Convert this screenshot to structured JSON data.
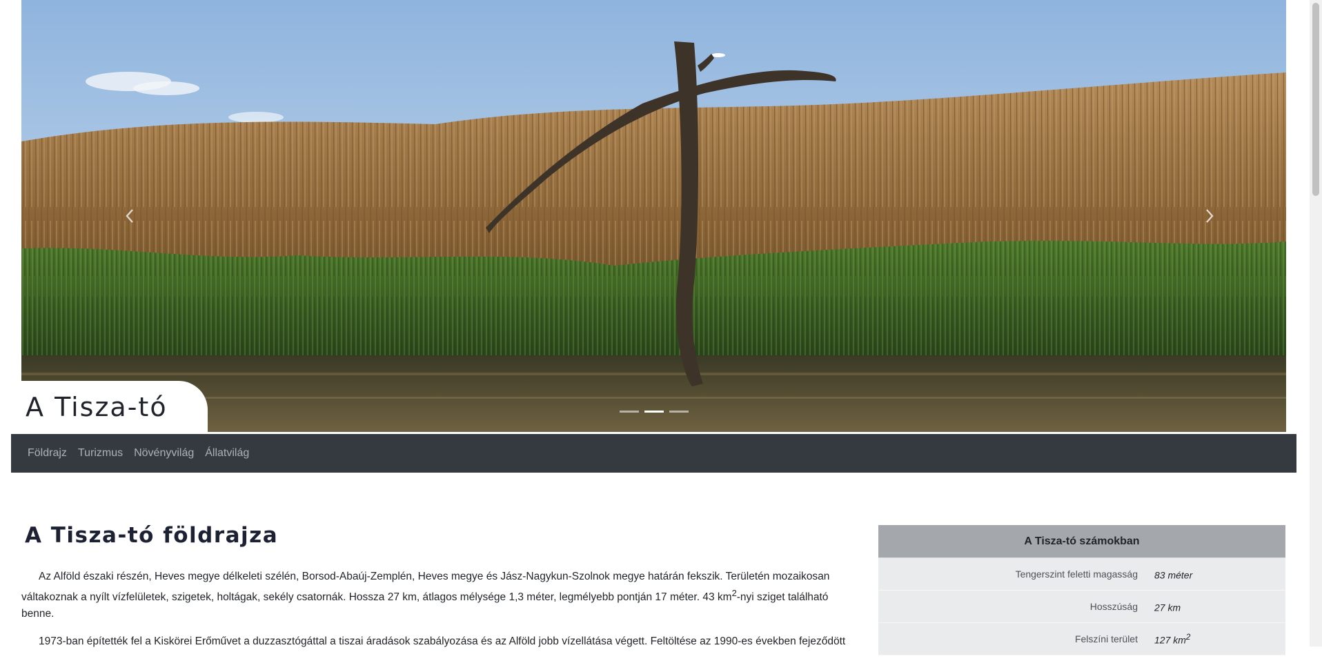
{
  "carousel": {
    "site_title": "A Tisza-tó",
    "prev_icon": "chevron-left-icon",
    "next_icon": "chevron-right-icon",
    "slide_count": 3,
    "active_slide": 2
  },
  "nav": {
    "items": [
      {
        "label": "Földrajz"
      },
      {
        "label": "Turizmus"
      },
      {
        "label": "Növényvilág"
      },
      {
        "label": "Állatvilág"
      }
    ]
  },
  "main": {
    "heading": "A Tisza-tó földrajza",
    "p1_before_sup": "Az Alföld északi részén, Heves megye délkeleti szélén, Borsod-Abaúj-Zemplén, Heves megye és Jász-Nagykun-Szolnok megye határán fekszik. Területén mozaikosan váltakoznak a nyílt vízfelületek, szigetek, holtágak, sekély csatornák. Hossza 27 km, átlagos mélysége 1,3 méter, legmélyebb pontján 17 méter. 43 km",
    "p1_sup": "2",
    "p1_after_sup": "-nyi sziget található benne.",
    "p2": "1973-ban építették fel a Kiskörei Erőművet a duzzasztógáttal a tiszai áradások szabályozása és az Alföld jobb vízellátása végett. Feltöltése az 1990-es években fejeződött"
  },
  "info": {
    "title": "A Tisza-tó számokban",
    "rows": [
      {
        "label": "Tengerszint feletti magasság",
        "value": "83 méter",
        "sup": ""
      },
      {
        "label": "Hosszúság",
        "value": "27 km",
        "sup": ""
      },
      {
        "label": "Felszíni terület",
        "value": "127 km",
        "sup": "2"
      }
    ]
  }
}
